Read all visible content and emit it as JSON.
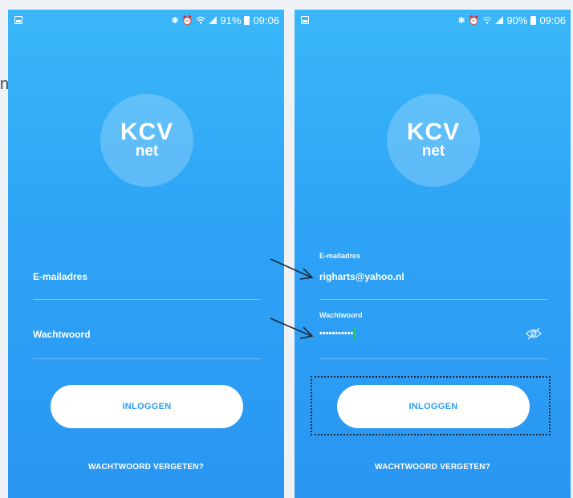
{
  "stray_text": "n",
  "left_phone": {
    "status": {
      "battery": "91%",
      "time": "09:06"
    },
    "logo": {
      "main": "KCV",
      "sub": "net"
    },
    "email_label": "E-mailadres",
    "password_label": "Wachtwoord",
    "login_label": "INLOGGEN",
    "forgot_label": "WACHTWOORD VERGETEN?"
  },
  "right_phone": {
    "status": {
      "battery": "90%",
      "time": "09:06"
    },
    "logo": {
      "main": "KCV",
      "sub": "net"
    },
    "email_label": "E-mailadres",
    "email_value": "righarts@yahoo.nl",
    "password_label": "Wachtwoord",
    "password_value": "•••••••••••",
    "login_label": "INLOGGEN",
    "forgot_label": "WACHTWOORD VERGETEN?"
  },
  "icons": [
    "bluetooth-icon",
    "alarm-icon",
    "wifi-icon",
    "signal-icon",
    "battery-icon",
    "eye-off-icon"
  ],
  "colors": {
    "background_top": "#3ab7f8",
    "background_bottom": "#2a96f2",
    "button_text": "#2d9ff0",
    "cursor": "#1ccc74"
  }
}
